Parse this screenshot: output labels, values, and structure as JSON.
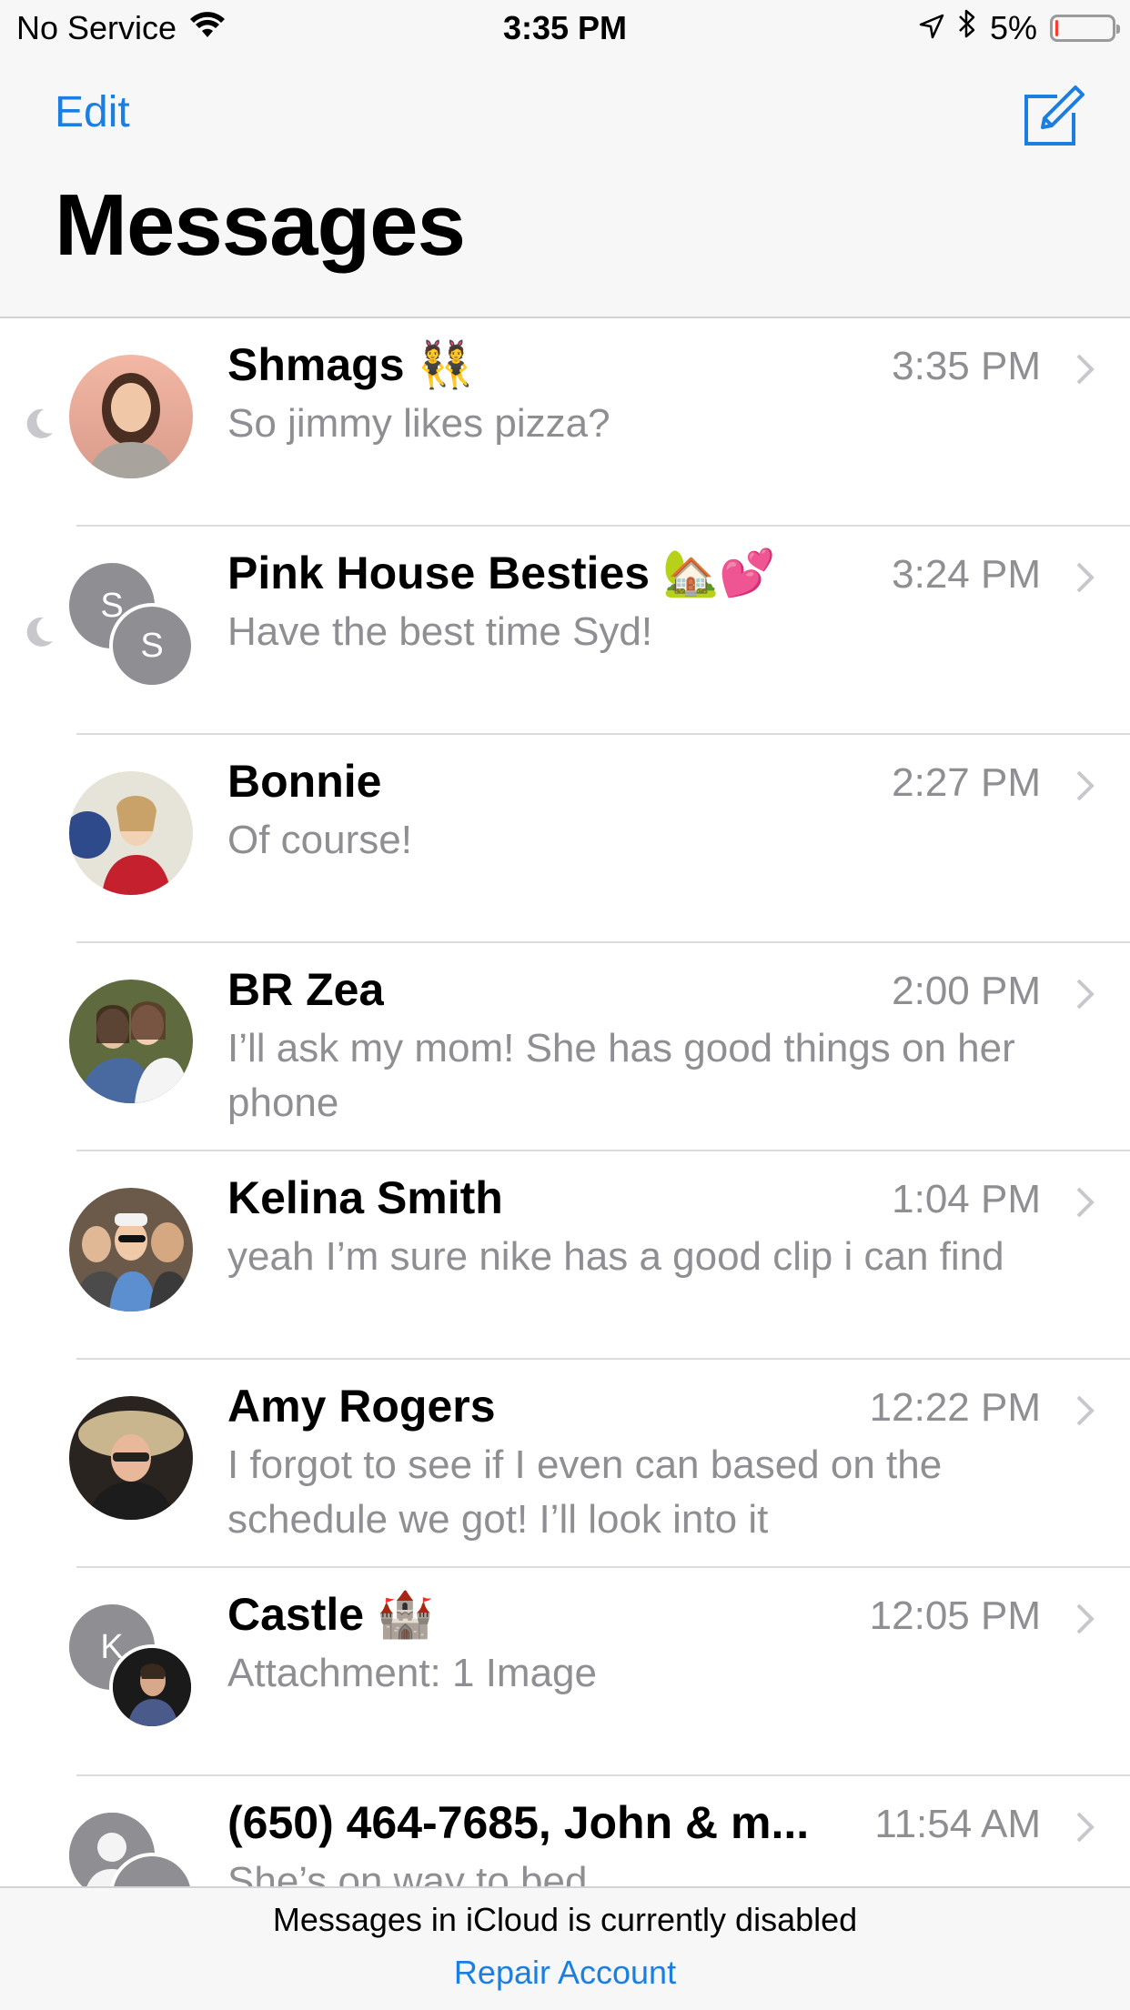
{
  "status_bar": {
    "carrier": "No Service",
    "time": "3:35 PM",
    "battery": "5%",
    "battery_level": 0.05,
    "icons": [
      "wifi-icon",
      "location-icon",
      "bluetooth-icon",
      "battery-icon"
    ]
  },
  "header": {
    "edit_label": "Edit",
    "title": "Messages",
    "compose_icon": "compose-icon",
    "accent_color": "#1a7fe0"
  },
  "conversations": [
    {
      "name": "Shmags 👯",
      "time": "3:35 PM",
      "preview": "So jimmy likes pizza?",
      "muted": true,
      "avatar": "photo"
    },
    {
      "name": "Pink House Besties 🏡💕",
      "time": "3:24 PM",
      "preview": "Have the best time Syd!",
      "muted": true,
      "avatar": "group",
      "avatar_initials": [
        "S",
        "S"
      ]
    },
    {
      "name": "Bonnie",
      "time": "2:27 PM",
      "preview": "Of course!",
      "muted": false,
      "avatar": "photo"
    },
    {
      "name": "BR Zea",
      "time": "2:00 PM",
      "preview": "I’ll ask my mom! She has good things on her phone",
      "muted": false,
      "avatar": "photo"
    },
    {
      "name": "Kelina Smith",
      "time": "1:04 PM",
      "preview": "yeah I’m sure nike has a good clip i can find",
      "muted": false,
      "avatar": "photo"
    },
    {
      "name": "Amy Rogers",
      "time": "12:22 PM",
      "preview": "I forgot to see if I even can based on the schedule we got! I’ll look into it",
      "muted": false,
      "avatar": "photo"
    },
    {
      "name": "Castle 🏰",
      "time": "12:05 PM",
      "preview": "Attachment: 1 Image",
      "muted": false,
      "avatar": "group",
      "avatar_initials": [
        "K",
        ""
      ]
    },
    {
      "name": "(650) 464-7685, John & m...",
      "time": "11:54 AM",
      "preview": "She’s on way to bed",
      "muted": false,
      "avatar": "group",
      "avatar_initials": [
        "",
        ""
      ]
    }
  ],
  "banner": {
    "message": "Messages in iCloud is currently disabled",
    "link": "Repair Account"
  }
}
